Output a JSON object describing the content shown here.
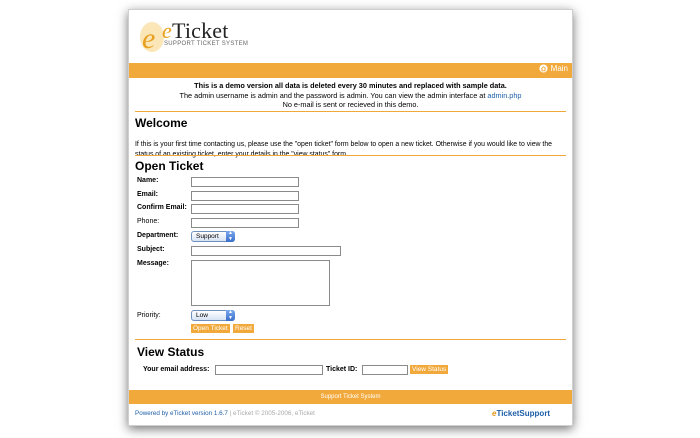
{
  "header": {
    "logo_letter": "e",
    "title_prefix": "e",
    "title_rest": "Ticket",
    "subtitle": "SUPPORT TICKET SYSTEM",
    "main_link": "Main"
  },
  "notice": {
    "line1": "This is a demo version all data is deleted every 30 minutes and replaced with sample data.",
    "line2_prefix": "The admin username is admin and the password is admin. You can view the admin interface at ",
    "line2_link": "admin.php",
    "line3": "No e-mail is sent or recieved in this demo."
  },
  "welcome": {
    "title": "Welcome",
    "text": "If this is your first time contacting us, please use the \"open ticket\" form below to open a new ticket. Otherwise if you would like to view the status of an existing ticket, enter your details in the \"view status\" form."
  },
  "open_ticket": {
    "title": "Open Ticket",
    "name_label": "Name:",
    "email_label": "Email:",
    "confirm_email_label": "Confirm Email:",
    "phone_label": "Phone:",
    "department_label": "Department:",
    "department_value": "Support",
    "subject_label": "Subject:",
    "message_label": "Message:",
    "priority_label": "Priority:",
    "priority_value": "Low",
    "open_button": "Open Ticket",
    "reset_button": "Reset"
  },
  "view_status": {
    "title": "View Status",
    "email_label": "Your email address:",
    "ticket_label": "Ticket ID:",
    "button": "View Status"
  },
  "footer": {
    "bar_text": "Support Ticket System",
    "powered": "Powered by eTicket version 1.6.7",
    "copyright": " | eTicket © 2005-2006, eTicket",
    "logo_prefix": "e",
    "logo_rest": "TicketSupport"
  },
  "colors": {
    "accent": "#f2a93c",
    "link": "#1e5ea8"
  }
}
